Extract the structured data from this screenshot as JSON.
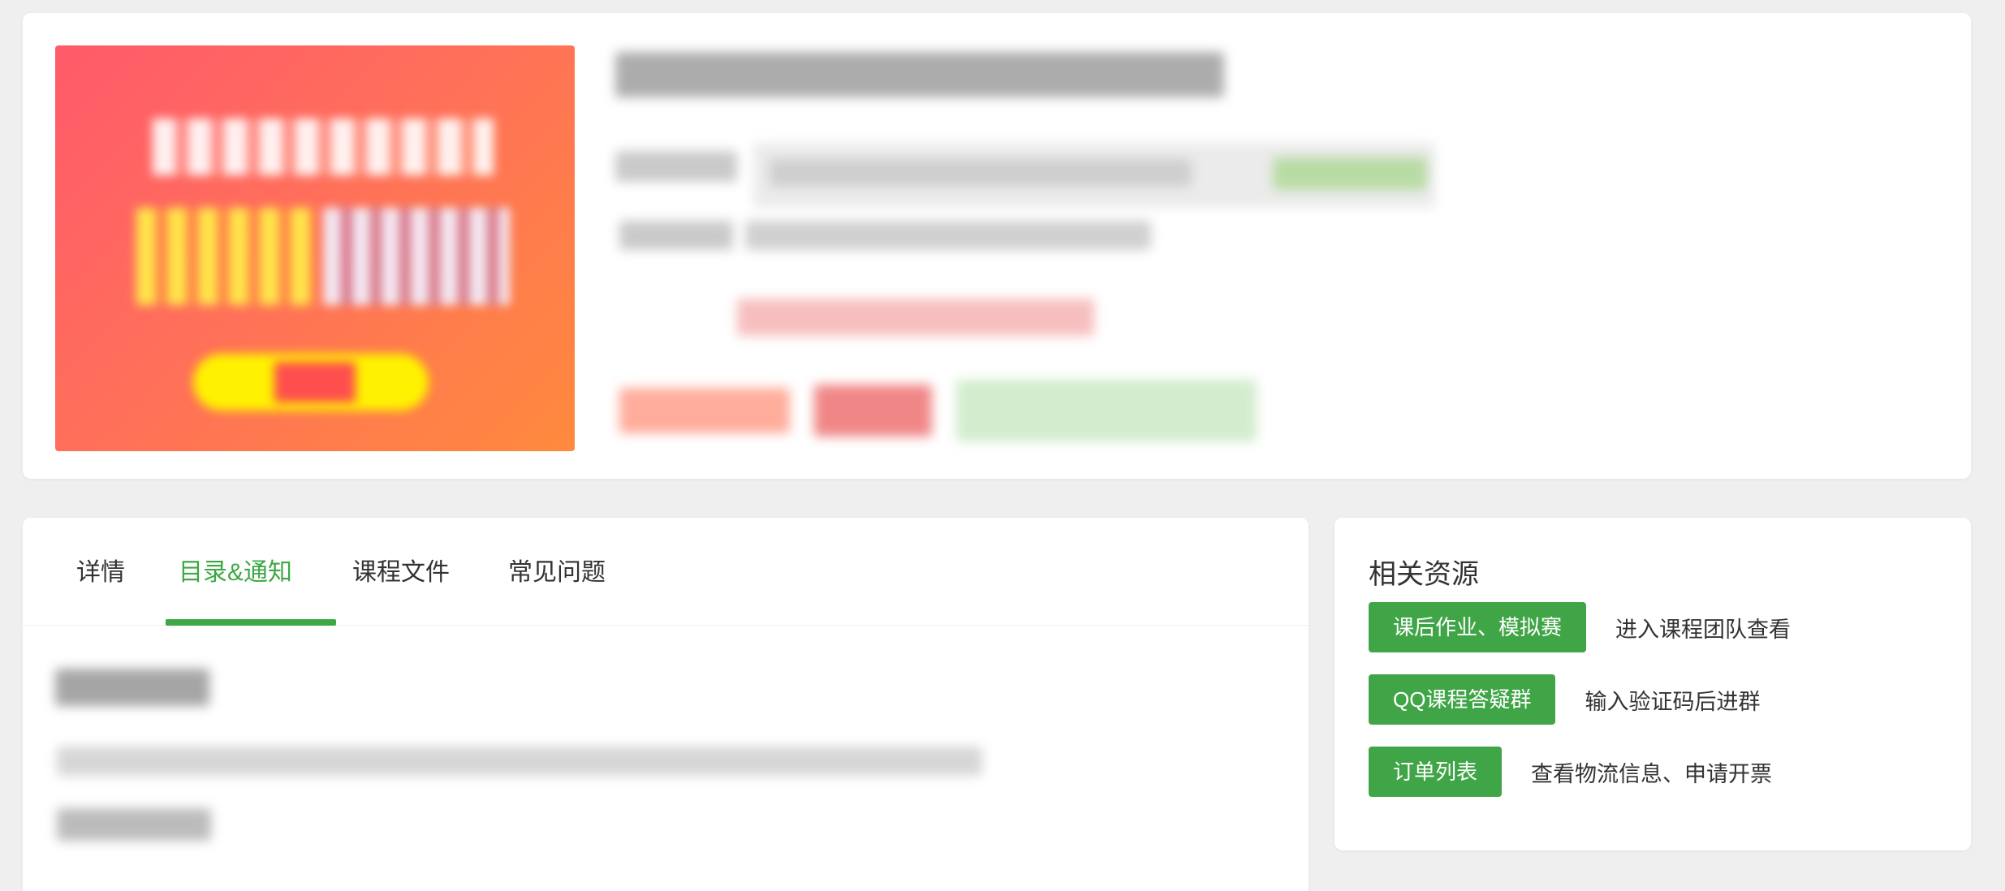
{
  "colors": {
    "accent_green": "#3da845",
    "button_green": "#40a547",
    "page_bg": "#efefef"
  },
  "tabs": [
    {
      "label": "详情",
      "active": false
    },
    {
      "label": "目录&通知",
      "active": true
    },
    {
      "label": "课程文件",
      "active": false
    },
    {
      "label": "常见问题",
      "active": false
    }
  ],
  "resources": {
    "title": "相关资源",
    "items": [
      {
        "button": "课后作业、模拟赛",
        "description": "进入课程团队查看"
      },
      {
        "button": "QQ课程答疑群",
        "description": "输入验证码后进群"
      },
      {
        "button": "订单列表",
        "description": "查看物流信息、申请开票"
      }
    ]
  }
}
